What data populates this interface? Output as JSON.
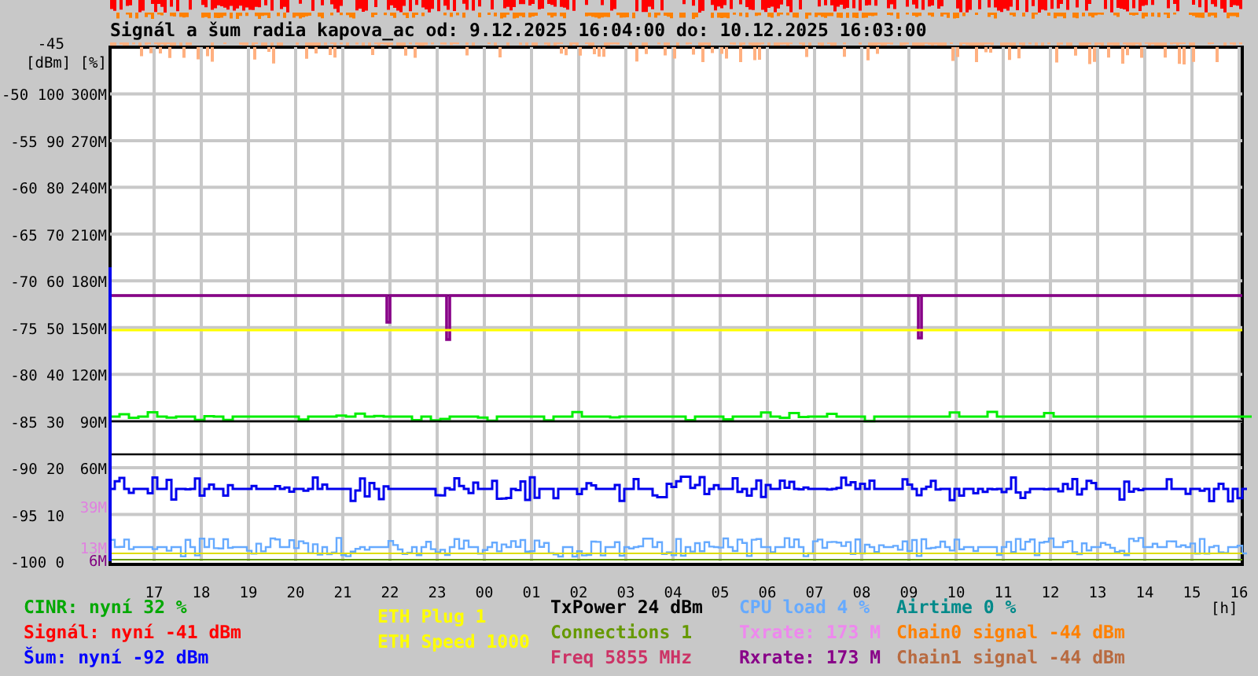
{
  "title": "Signál a šum radia kapova_ac od: 9.12.2025 16:04:00 do: 10.12.2025 16:03:00",
  "y_axis": {
    "units": "[dBm] [%]",
    "rows": [
      {
        "dbm": "-45"
      },
      {
        "dbm": "-50",
        "percent": "100",
        "rate": "300M"
      },
      {
        "dbm": "-55",
        "percent": "90",
        "rate": "270M"
      },
      {
        "dbm": "-60",
        "percent": "80",
        "rate": "240M"
      },
      {
        "dbm": "-65",
        "percent": "70",
        "rate": "210M"
      },
      {
        "dbm": "-70",
        "percent": "60",
        "rate": "180M"
      },
      {
        "dbm": "-75",
        "percent": "50",
        "rate": "150M"
      },
      {
        "dbm": "-80",
        "percent": "40",
        "rate": "120M"
      },
      {
        "dbm": "-85",
        "percent": "30",
        "rate": "90M"
      },
      {
        "dbm": "-90",
        "percent": "20",
        "rate": "60M"
      },
      {
        "dbm": "-95",
        "percent": "10"
      },
      {
        "dbm": "-100",
        "percent": "0"
      }
    ]
  },
  "rate_marks": [
    {
      "label": "39M",
      "color": "#e080e0"
    },
    {
      "label": "13M",
      "color": "#e080e0"
    },
    {
      "label": "6M",
      "color": "#800080"
    }
  ],
  "x_axis": {
    "hours": [
      "17",
      "18",
      "19",
      "20",
      "21",
      "22",
      "23",
      "00",
      "01",
      "02",
      "03",
      "04",
      "05",
      "06",
      "07",
      "08",
      "09",
      "10",
      "11",
      "12",
      "13",
      "14",
      "15",
      "16"
    ],
    "unit": "[h]"
  },
  "legend": [
    {
      "items": [
        {
          "text": "CINR: nyní 32 %",
          "color": "#00a800"
        },
        {
          "text": "Signál: nyní -41 dBm",
          "color": "#ff0000"
        },
        {
          "text": "Šum: nyní -92 dBm",
          "color": "#0000ff"
        }
      ]
    },
    {
      "items": [
        {
          "text": "ETH Plug 1",
          "color": "#ffff00"
        },
        {
          "text": "ETH Speed 1000",
          "color": "#ffff00"
        }
      ]
    },
    {
      "items": [
        {
          "text": "TxPower 24 dBm",
          "color": "#000000"
        },
        {
          "text": "Connections 1",
          "color": "#669900"
        },
        {
          "text": "Freq 5855 MHz",
          "color": "#cc3366"
        }
      ]
    },
    {
      "items": [
        {
          "text": "CPU load 4 %",
          "color": "#66aaff"
        },
        {
          "text": "Txrate: 173 M",
          "color": "#ee88ee"
        },
        {
          "text": "Rxrate: 173 M",
          "color": "#880088"
        }
      ]
    },
    {
      "items": [
        {
          "text": "Airtime 0 %",
          "color": "#008a8a"
        },
        {
          "text": "Chain0 signal -44 dBm",
          "color": "#ff8000"
        },
        {
          "text": "Chain1 signal -44 dBm",
          "color": "#b86a40"
        }
      ]
    }
  ]
}
